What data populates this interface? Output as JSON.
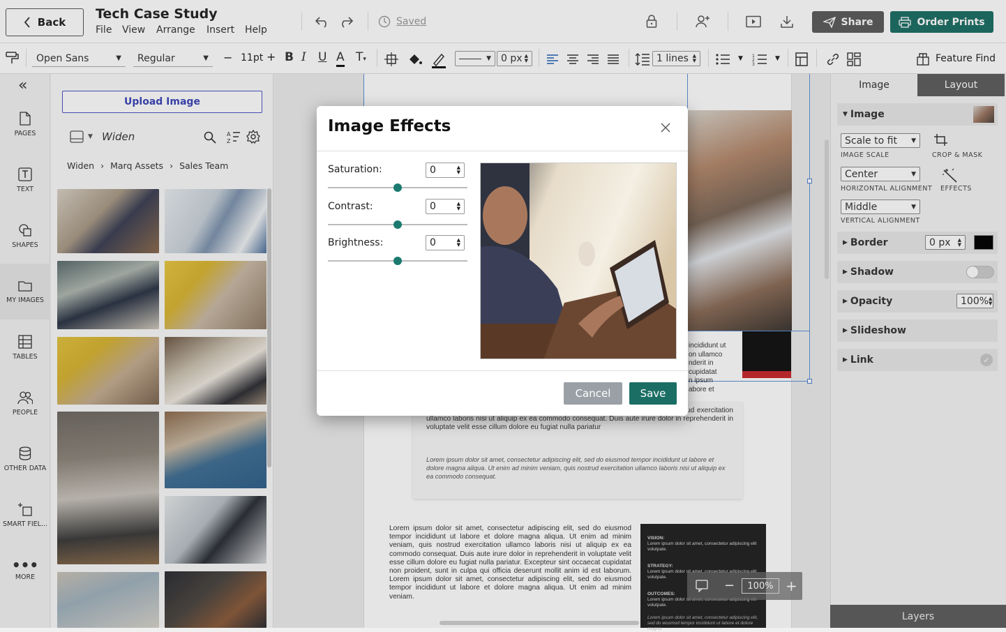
{
  "header": {
    "back_label": "Back",
    "title": "Tech Case Study",
    "menu": [
      "File",
      "View",
      "Arrange",
      "Insert",
      "Help"
    ],
    "saved_label": "Saved",
    "share_label": "Share",
    "order_label": "Order Prints"
  },
  "toolbar": {
    "font_family": "Open Sans",
    "font_weight": "Regular",
    "font_size": "11pt",
    "line_width": "0 px",
    "line_spacing": "1 lines",
    "feature_find": "Feature Find"
  },
  "rail": {
    "items": [
      "PAGES",
      "TEXT",
      "SHAPES",
      "MY IMAGES",
      "TABLES",
      "PEOPLE",
      "OTHER DATA",
      "SMART FIEL...",
      "MORE"
    ]
  },
  "images_panel": {
    "upload_label": "Upload Image",
    "source": "Widen",
    "breadcrumb": [
      "Widen",
      "Marq Assets",
      "Sales Team"
    ]
  },
  "right_panel": {
    "tab_image": "Image",
    "tab_layout": "Layout",
    "image_section": "Image",
    "scale_value": "Scale to fit",
    "scale_label": "IMAGE SCALE",
    "crop_label": "CROP & MASK",
    "halign_value": "Center",
    "halign_label": "HORIZONTAL ALIGNMENT",
    "effects_label": "EFFECTS",
    "valign_value": "Middle",
    "valign_label": "VERTICAL ALIGNMENT",
    "border_label": "Border",
    "border_value": "0 px",
    "border_color": "#000000",
    "shadow_label": "Shadow",
    "opacity_label": "Opacity",
    "opacity_value": "100%",
    "slideshow_label": "Slideshow",
    "link_label": "Link",
    "layers_label": "Layers"
  },
  "modal": {
    "title": "Image Effects",
    "saturation_label": "Saturation:",
    "saturation_value": "0",
    "contrast_label": "Contrast:",
    "contrast_value": "0",
    "brightness_label": "Brightness:",
    "brightness_value": "0",
    "slider_positions": {
      "saturation": 0.5,
      "contrast": 0.5,
      "brightness": 0.5
    },
    "cancel_label": "Cancel",
    "save_label": "Save"
  },
  "canvas": {
    "zoom": "100%",
    "behind_text_1": "incididunt ut",
    "behind_text_2": "on ullamco",
    "behind_text_3": "nderit in",
    "behind_text_4": "cupidatat",
    "behind_text_5": "n ipsum",
    "behind_text_6": "abore et",
    "para1": "incididunt ut labore et dolore magna aliqua. Ut enim ad minim veniam, quis nostrud exercitation ullamco laboris nisi ut aliquip ex ea commodo consequat. Duis aute irure dolor in reprehenderit in voluptate velit esse cillum dolore eu fugiat nulla pariatur",
    "para2": "Lorem ipsum dolor sit amet, consectetur adipiscing elit, sed do eiusmod tempor incididunt ut labore et dolore magna aliqua. Ut enim ad minim veniam, quis nostrud exercitation ullamco laboris nisi ut aliquip ex ea commodo consequat.",
    "para3": "Lorem ipsum dolor sit amet, consectetur adipiscing elit, sed do eiusmod tempor incididunt ut labore et dolore magna aliqua. Ut enim ad minim veniam, quis nostrud exercitation ullamco laboris nisi ut aliquip ex ea commodo consequat. Duis aute irure dolor in reprehenderit in voluptate velit esse cillum dolore eu fugiat nulla pariatur. Excepteur sint occaecat cupidatat non proident, sunt in culpa qui officia deserunt mollit anim id est laborum. Lorem ipsum dolor sit amet, consectetur adipiscing elit, sed do eiusmod tempor incididunt ut labore et dolore magna aliqua. Ut enim ad minim veniam.",
    "vision_label": "VISION:",
    "vision_text": "Lorem ipsum dolor sit amet, consectetur adipiscing elit volutpate.",
    "strategy_label": "STRATEGY:",
    "strategy_text": "Lorem ipsum dolor sit amet, consectetur adipiscing elit volutpate.",
    "outcomes_label": "OUTCOMES:",
    "outcomes_text": "Lorem ipsum dolor sit amet, consectetur adipiscing elit volutpate.",
    "quote_text": "Lorem ipsum dolor sit amet, consectetur adipiscing elit, sed do eiusmod tempor incididunt ut labore et dolore magna"
  }
}
